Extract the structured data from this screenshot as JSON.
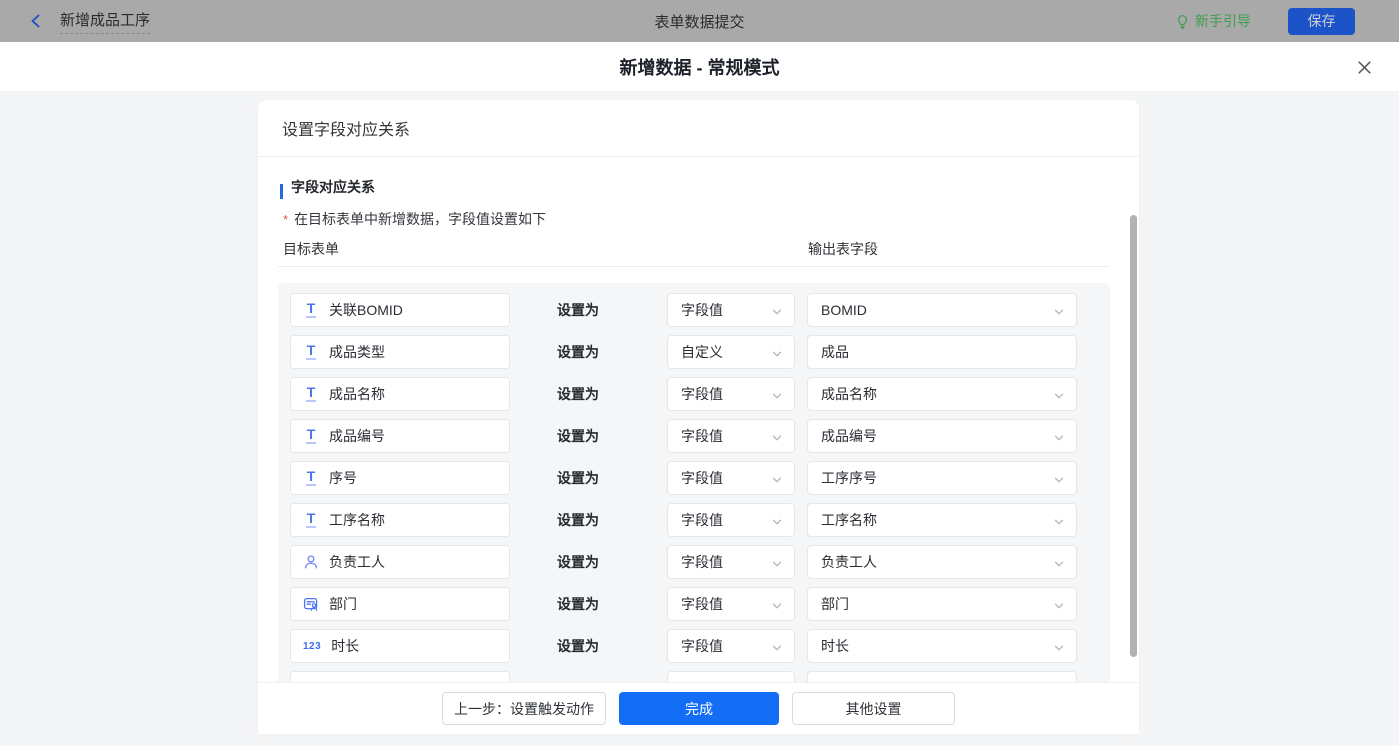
{
  "colors": {
    "primary_blue": "#146EF5",
    "field_icon_blue": "#4E74F2",
    "guide_green": "#3F9E4F",
    "required_red": "#E34D59",
    "topbar_dimmed_bg": "#A9A9AA",
    "save_button_blue": "#1C53C9",
    "scrollbar_gray": "#B0B2B4",
    "rows_panel_bg": "#F5F6F8"
  },
  "topbar": {
    "back_title": "新增成品工序",
    "center_title": "表单数据提交",
    "guide_label": "新手引导",
    "save_label": "保存"
  },
  "modal": {
    "title": "新增数据 - 常规模式"
  },
  "card": {
    "header": "设置字段对应关系",
    "section_title": "字段对应关系",
    "required_mark": "*",
    "note": "在目标表单中新增数据，字段值设置如下",
    "columns": {
      "left": "目标表单",
      "right": "输出表字段"
    },
    "set_as_label": "设置为",
    "number_icon_glyph": "123",
    "rows": [
      {
        "icon": "text-field-icon",
        "field": "关联BOMID",
        "mode": "字段值",
        "value": "BOMID",
        "value_type": "select"
      },
      {
        "icon": "text-field-icon",
        "field": "成品类型",
        "mode": "自定义",
        "value": "成品",
        "value_type": "input"
      },
      {
        "icon": "text-field-icon",
        "field": "成品名称",
        "mode": "字段值",
        "value": "成品名称",
        "value_type": "select"
      },
      {
        "icon": "text-field-icon",
        "field": "成品编号",
        "mode": "字段值",
        "value": "成品编号",
        "value_type": "select"
      },
      {
        "icon": "text-field-icon",
        "field": "序号",
        "mode": "字段值",
        "value": "工序序号",
        "value_type": "select"
      },
      {
        "icon": "text-field-icon",
        "field": "工序名称",
        "mode": "字段值",
        "value": "工序名称",
        "value_type": "select"
      },
      {
        "icon": "user-icon",
        "field": "负责工人",
        "mode": "字段值",
        "value": "负责工人",
        "value_type": "select"
      },
      {
        "icon": "department-icon",
        "field": "部门",
        "mode": "字段值",
        "value": "部门",
        "value_type": "select"
      },
      {
        "icon": "number-icon",
        "field": "时长",
        "mode": "字段值",
        "value": "时长",
        "value_type": "select"
      }
    ]
  },
  "footer": {
    "prev_label": "上一步：设置触发动作",
    "done_label": "完成",
    "other_label": "其他设置"
  }
}
